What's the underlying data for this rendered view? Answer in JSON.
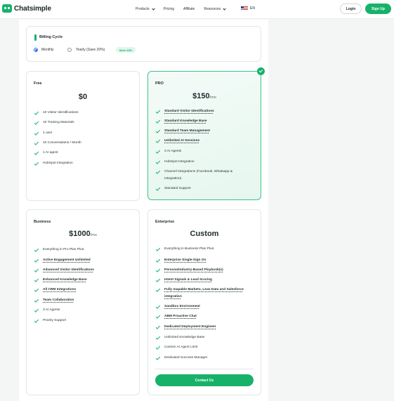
{
  "nav": {
    "logo_text": "Chatsimple",
    "links": [
      "Products",
      "Pricing",
      "Affiliate",
      "Resources"
    ],
    "language": "EN",
    "login": "Login",
    "signup": "Sign Up"
  },
  "billing": {
    "title": "Billing Cycle",
    "monthly": "Monthly",
    "yearly": "Yearly (Save 20%)",
    "save_badge": "Save 20%",
    "selected": "Monthly"
  },
  "plans": {
    "free": {
      "name": "Free",
      "price": "$0",
      "per": "",
      "features": [
        "10 Visitor Identifications",
        "10 Training Materials",
        "1 user",
        "10 Conversations / Month",
        "1 AI agent",
        "HubSpot Integration"
      ]
    },
    "pro": {
      "name": "PRO",
      "price": "$150",
      "per": "/mo",
      "features": [
        "Standard Visitor Identifications",
        "Standard Knowledge Base",
        "Standard Team Management",
        "Unlimited AI Sessions",
        "3 AI Agents",
        "HubSpot Integration",
        "Channel Integrations (Facebook, Whatsapp &",
        "Integration)",
        "Standard Support"
      ]
    },
    "business": {
      "name": "Business",
      "price": "$1000",
      "per": "/mo",
      "features": [
        "Everything in Pro Plan Plus:",
        "Active Engagement Unlimited",
        "Advanced Visitor Identifications",
        "Enhanced Knowledge Base",
        "All CRM Integrations",
        "Team Collaboration",
        "3 AI Agents",
        "Priority Support"
      ]
    },
    "enterprise": {
      "name": "Enterprise",
      "price": "Custom",
      "features": [
        "Everything in Business Plan Plus:",
        "Enterprise Single-Sign On",
        "Persona/Industry-Based Playbook(s)",
        "Intent Signals & Lead Scoring",
        "Fully mapable Marketo, Lean Data and Salesforce",
        "integration",
        "Sandbox Environment",
        "ABM Proactive Chat",
        "Dedicated Deployment Engineer",
        "Unlimited Knowledge Base",
        "Custom AI Agent Limit",
        "Dedicated Success Manager"
      ],
      "contact": "Contact Us"
    }
  },
  "colors": {
    "accent": "#17b26a",
    "pro_border": "#3cc489",
    "radio": "#2f6ee6"
  }
}
